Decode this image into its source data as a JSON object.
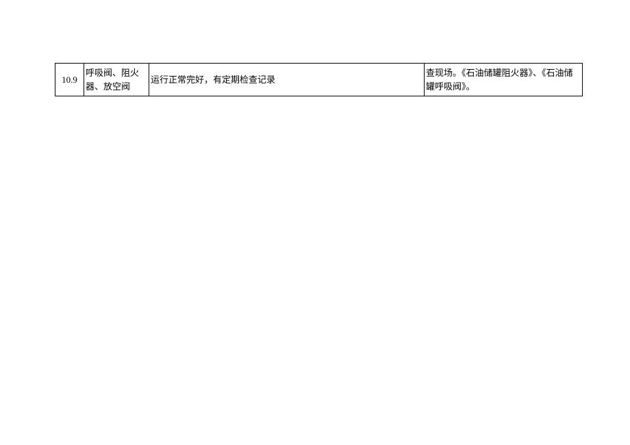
{
  "table": {
    "rows": [
      {
        "number": "10.9",
        "item": "呼吸阀、阻火器、放空阀",
        "description": "运行正常完好，有定期检查记录",
        "reference": "查现场。《石油储罐阻火器》、《石油储罐呼吸阀》。"
      }
    ]
  }
}
